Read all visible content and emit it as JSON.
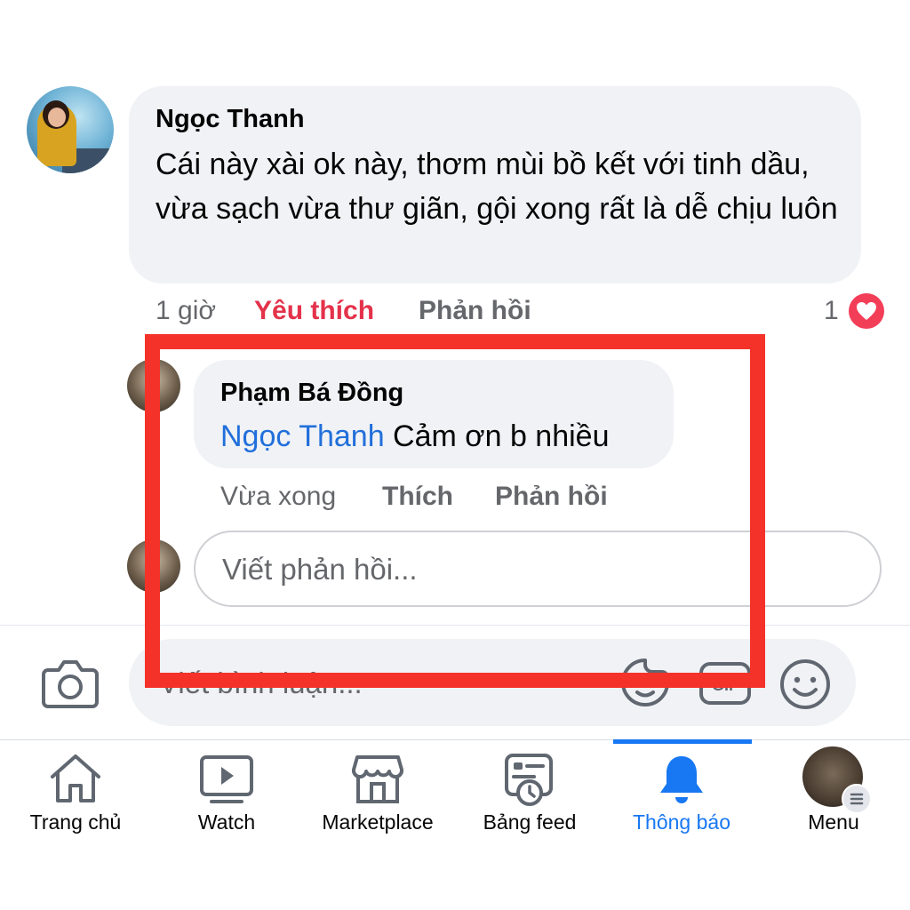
{
  "comment": {
    "author": "Ngọc Thanh",
    "text": "Cái này xài ok này, thơm mùi bồ kết với tinh dầu, vừa sạch vừa thư giãn, gội xong rất là dễ chịu luôn",
    "time": "1 giờ",
    "like_label": "Yêu thích",
    "reply_label": "Phản hồi",
    "reaction_count": "1"
  },
  "reply": {
    "author": "Phạm Bá Đồng",
    "mention": "Ngọc Thanh",
    "text": " Cảm ơn b nhiều",
    "time": "Vừa xong",
    "like_label": "Thích",
    "reply_label": "Phản hồi"
  },
  "reply_input": {
    "placeholder": "Viết phản hồi..."
  },
  "composer": {
    "placeholder": "Viết bình luận..."
  },
  "nav": {
    "home": "Trang chủ",
    "watch": "Watch",
    "marketplace": "Marketplace",
    "feed": "Bảng feed",
    "notifications": "Thông báo",
    "menu": "Menu"
  },
  "colors": {
    "accent": "#1877f2",
    "love": "#f33e58",
    "highlight": "#f4322a",
    "mention": "#216fdb"
  }
}
